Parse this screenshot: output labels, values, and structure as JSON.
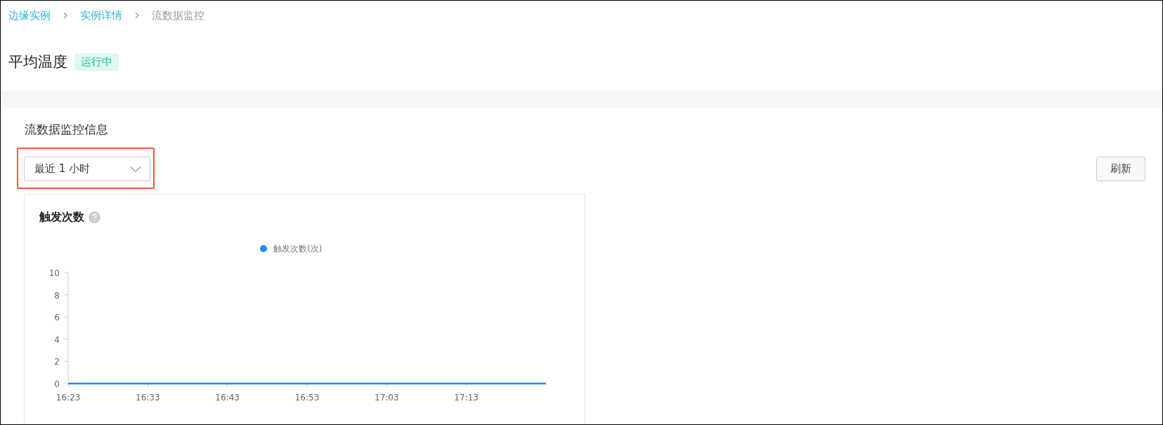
{
  "breadcrumb": [
    {
      "label": "边缘实例",
      "kind": "link"
    },
    {
      "label": "实例详情",
      "kind": "link"
    },
    {
      "label": "流数据监控",
      "kind": "current"
    }
  ],
  "title": "平均温度",
  "status_badge": "运行中",
  "section_title": "流数据监控信息",
  "time_range_select": {
    "value": "最近 1 小时",
    "highlighted": true
  },
  "refresh_button": "刷新",
  "chart_card": {
    "title": "触发次数",
    "help": true,
    "chart_data": {
      "type": "line",
      "categories": [
        "16:23",
        "16:33",
        "16:43",
        "16:53",
        "17:03",
        "17:13",
        null
      ],
      "series": [
        {
          "name": "触发次数(次)",
          "color": "#1890ff",
          "values": [
            0,
            0,
            0,
            0,
            0,
            0,
            0
          ]
        }
      ],
      "ylim": [
        0,
        10
      ],
      "yticks": [
        0,
        2,
        4,
        6,
        8,
        10
      ]
    }
  }
}
